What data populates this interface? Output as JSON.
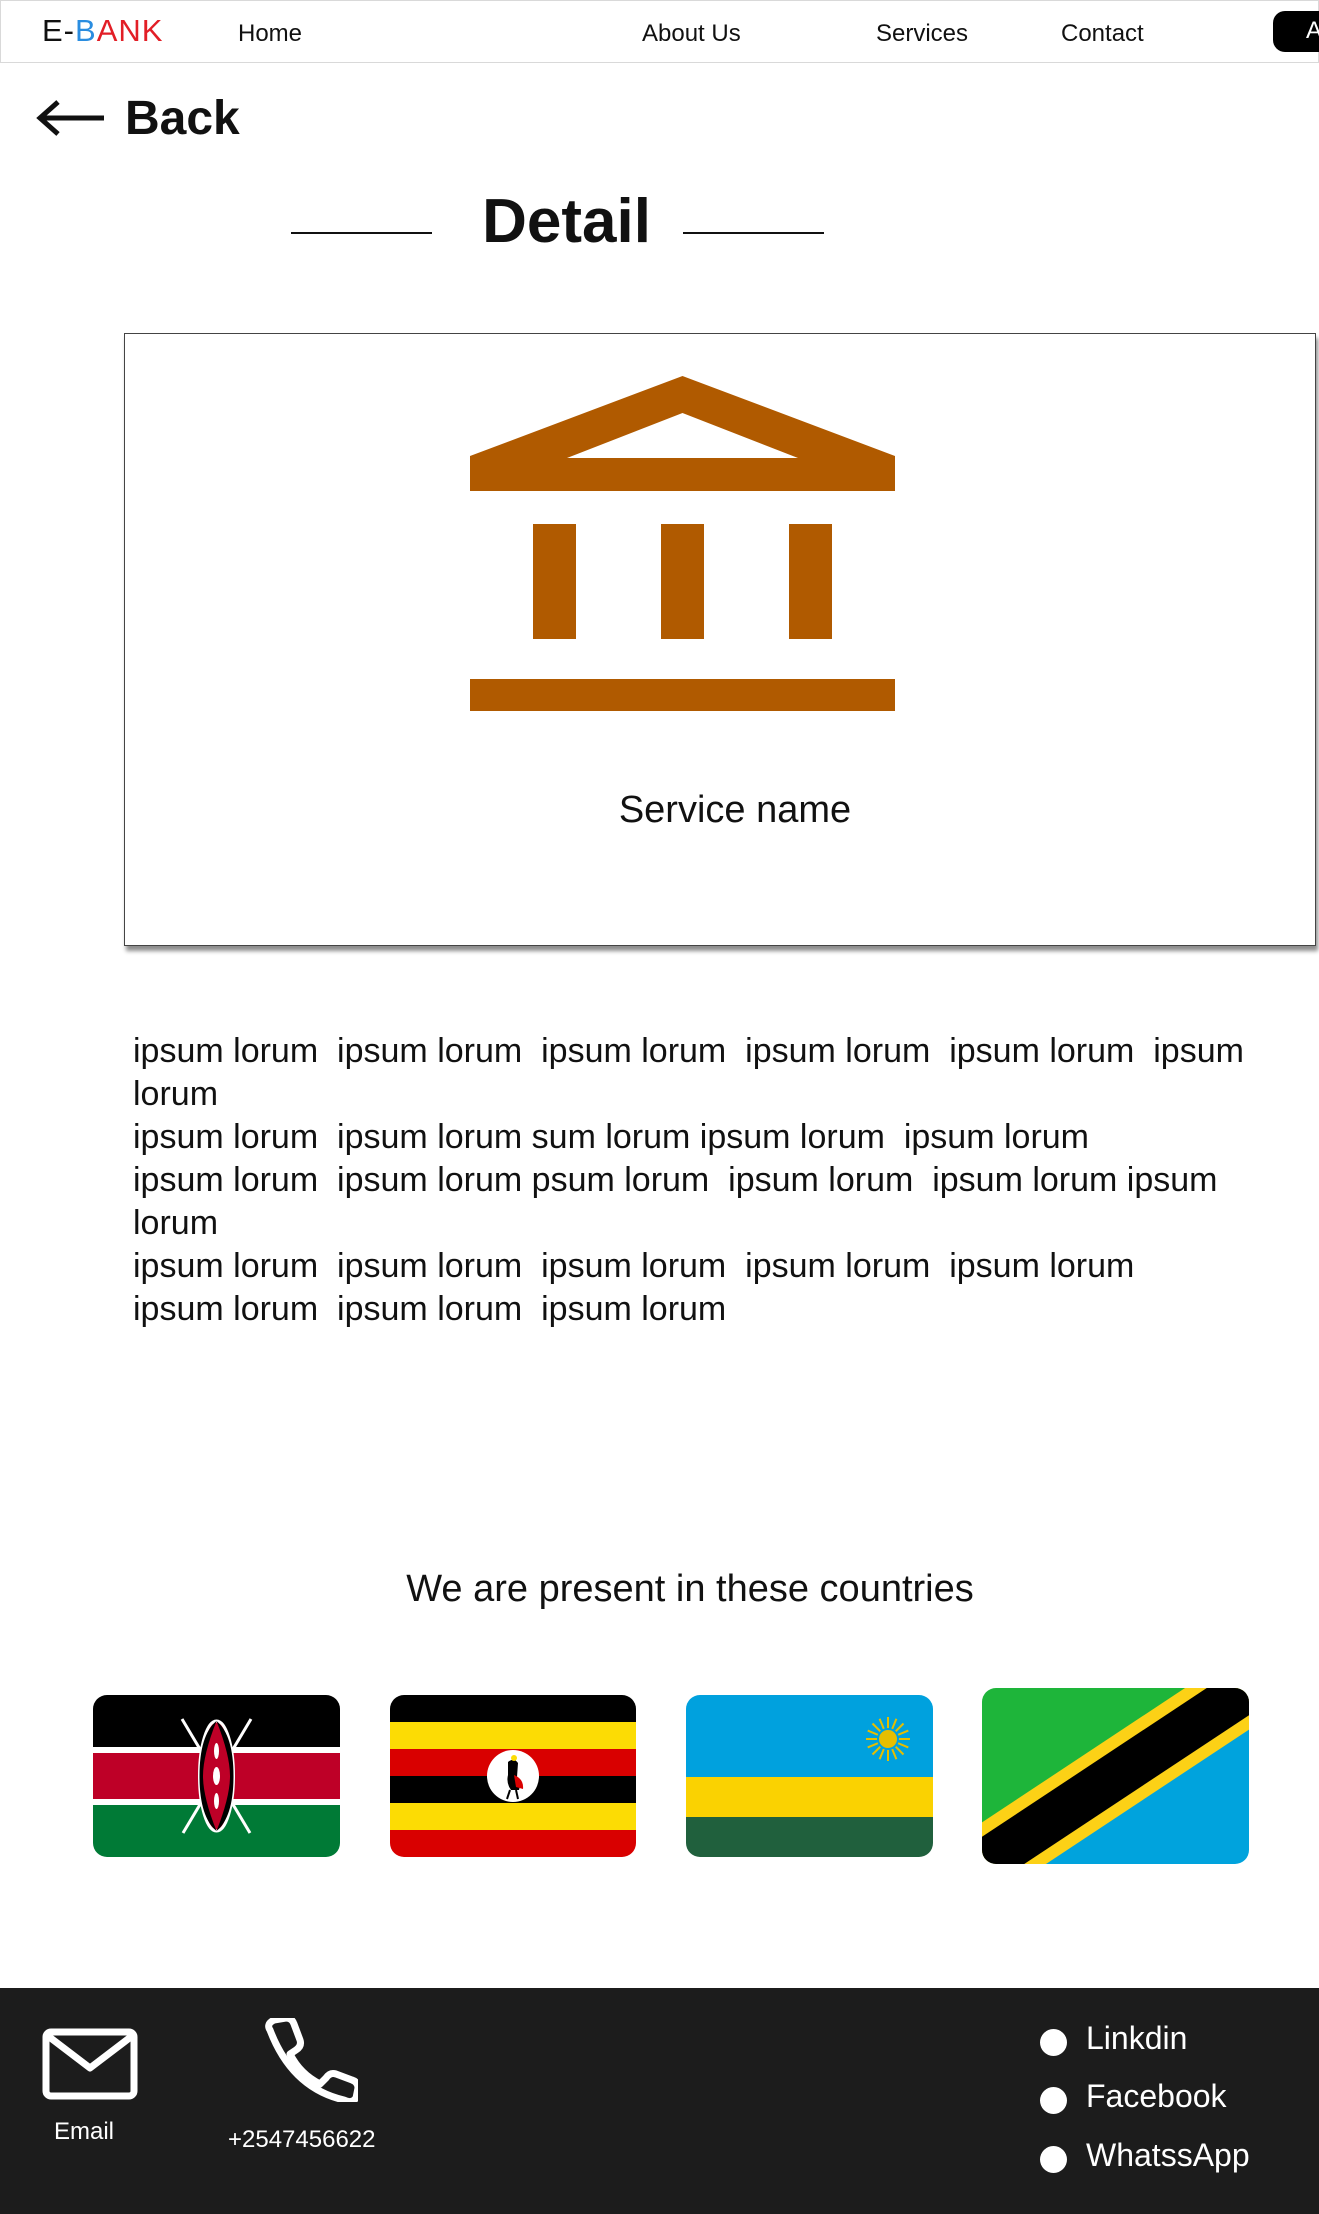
{
  "nav": {
    "logo": {
      "e": "E-",
      "b": "B",
      "an": "AN",
      "k": "K"
    },
    "links": [
      "Home",
      "About Us",
      "Services",
      "Contact"
    ],
    "cta_label": "A"
  },
  "back": {
    "label": "Back",
    "icon": "arrow-left-icon"
  },
  "detail": {
    "title": "Detail"
  },
  "service": {
    "icon": "bank-icon",
    "name": "Service name",
    "icon_color": "#b05a00"
  },
  "description": {
    "lines": [
      "ipsum lorum  ipsum lorum  ipsum lorum  ipsum lorum  ipsum lorum  ipsum",
      "lorum",
      "ipsum lorum  ipsum lorum sum lorum ipsum lorum  ipsum lorum",
      "ipsum lorum  ipsum lorum psum lorum  ipsum lorum  ipsum lorum ipsum",
      "lorum",
      "ipsum lorum  ipsum lorum  ipsum lorum  ipsum lorum  ipsum lorum",
      "ipsum lorum  ipsum lorum  ipsum lorum"
    ]
  },
  "countries": {
    "title": "We are present in these countries",
    "flags": [
      "kenya-flag",
      "uganda-flag",
      "rwanda-flag",
      "tanzania-flag"
    ]
  },
  "footer": {
    "background": "#1c1c1c",
    "email": {
      "icon": "mail-icon",
      "label": "Email"
    },
    "phone": {
      "icon": "phone-icon",
      "label": "+2547456622"
    },
    "social": [
      "Linkdin",
      "Facebook",
      "WhatssApp"
    ]
  }
}
